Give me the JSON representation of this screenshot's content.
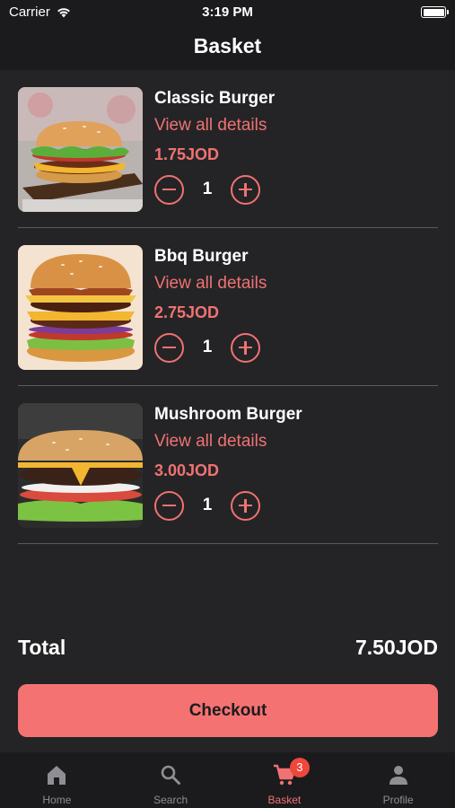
{
  "status_bar": {
    "carrier": "Carrier",
    "time": "3:19 PM",
    "wifi_icon": "wifi-icon",
    "battery_icon": "battery-icon"
  },
  "header": {
    "title": "Basket"
  },
  "items": [
    {
      "name": "Classic Burger",
      "details_link": "View all details",
      "price": "1.75JOD",
      "quantity": "1",
      "image": "classic-burger-image"
    },
    {
      "name": "Bbq Burger",
      "details_link": "View all details",
      "price": "2.75JOD",
      "quantity": "1",
      "image": "bbq-burger-image"
    },
    {
      "name": "Mushroom Burger",
      "details_link": "View all details",
      "price": "3.00JOD",
      "quantity": "1",
      "image": "mushroom-burger-image"
    }
  ],
  "summary": {
    "total_label": "Total",
    "total_value": "7.50JOD"
  },
  "checkout": {
    "label": "Checkout"
  },
  "tab_bar": {
    "tabs": [
      {
        "label": "Home",
        "icon": "home-icon",
        "active": false
      },
      {
        "label": "Search",
        "icon": "search-icon",
        "active": false
      },
      {
        "label": "Basket",
        "icon": "cart-icon",
        "active": true,
        "badge": "3"
      },
      {
        "label": "Profile",
        "icon": "person-icon",
        "active": false
      }
    ]
  },
  "colors": {
    "background": "#242426",
    "bar_background": "#1b1b1d",
    "accent": "#f07272",
    "checkout_button": "#f57272",
    "badge": "#f0473d",
    "inactive_tab": "#8e8e93"
  }
}
